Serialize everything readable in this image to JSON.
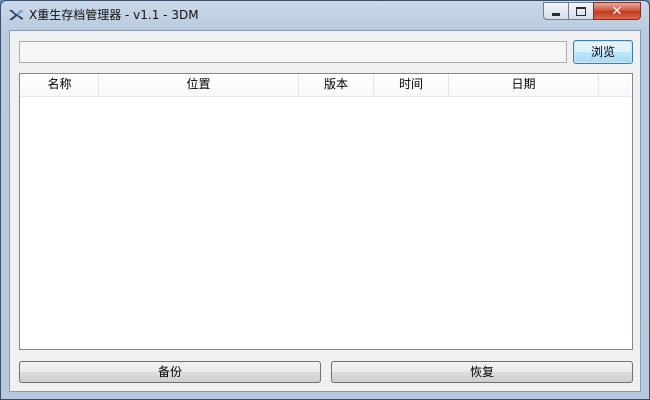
{
  "window": {
    "title": "X重生存档管理器 - v1.1 - 3DM",
    "controls": {
      "minimize": "minimize",
      "maximize": "maximize",
      "close": "✕"
    }
  },
  "path_input": {
    "value": "",
    "placeholder": ""
  },
  "browse_button": {
    "label": "浏览"
  },
  "table": {
    "columns": [
      "名称",
      "位置",
      "版本",
      "时间",
      "日期"
    ],
    "rows": []
  },
  "buttons": {
    "backup": "备份",
    "restore": "恢复"
  },
  "colors": {
    "title_gradient": "#b9cbe0",
    "close_button": "#c0391f",
    "focus_border": "#3c7fb1"
  }
}
